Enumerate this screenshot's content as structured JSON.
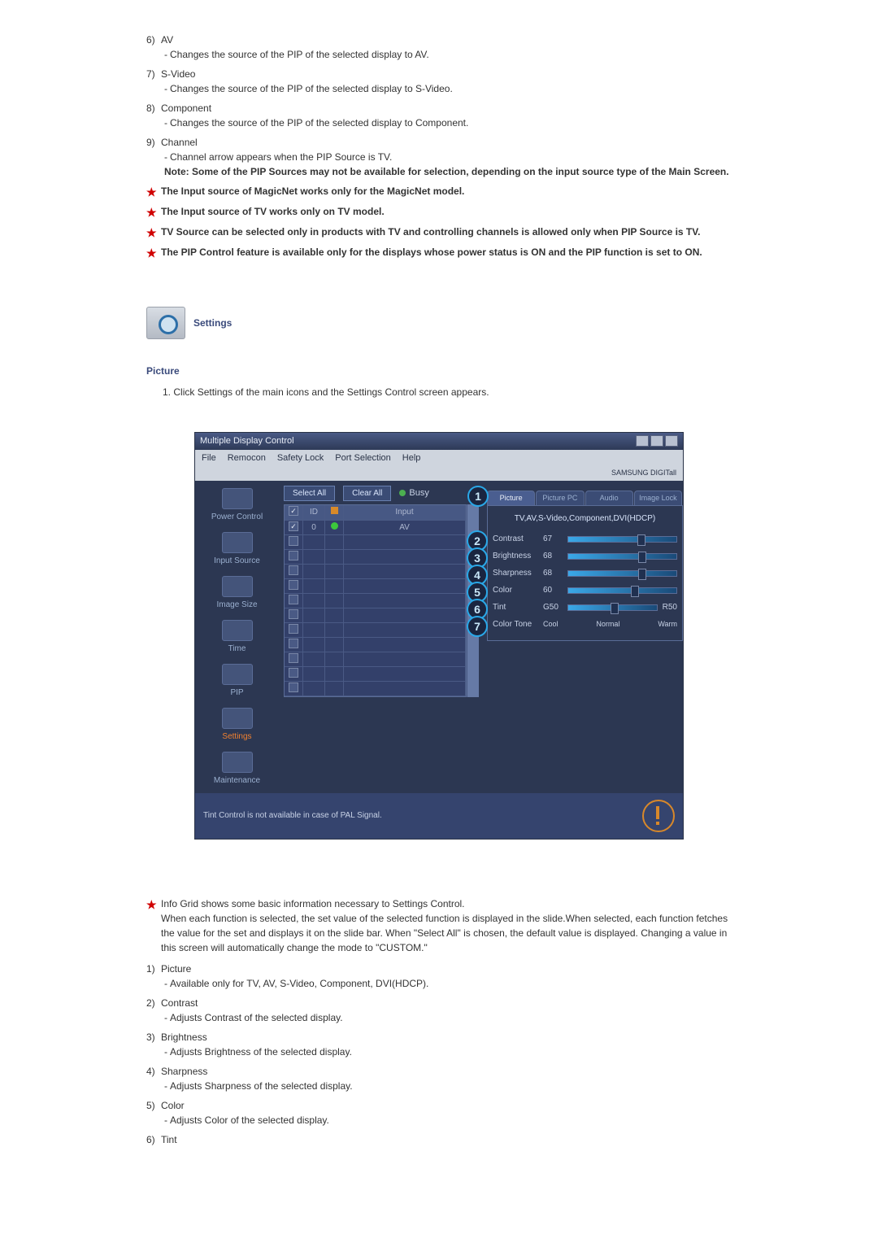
{
  "top_items": [
    {
      "num": "6)",
      "label": "AV",
      "desc": "Changes the source of the PIP of the selected display to AV."
    },
    {
      "num": "7)",
      "label": "S-Video",
      "desc": "Changes the source of the PIP of the selected display to S-Video."
    },
    {
      "num": "8)",
      "label": "Component",
      "desc": "Changes the source of the PIP of the selected display to Component."
    },
    {
      "num": "9)",
      "label": "Channel",
      "desc": "Channel arrow appears when the PIP Source is TV."
    }
  ],
  "channel_note": "Note: Some of the PIP Sources may not be available for selection, depending on the input source type of the Main Screen.",
  "stars_top": [
    "The Input source of MagicNet works only for the MagicNet model.",
    "The Input source of TV works only on TV model.",
    "TV Source can be selected only in products with TV and controlling channels is allowed only when PIP Source is TV.",
    "The PIP Control feature is available only for the displays whose power status is ON and the PIP function is set to ON."
  ],
  "settings_label": "Settings",
  "picture_label": "Picture",
  "picture_instr": "Click Settings of the main icons and the Settings Control screen appears.",
  "picture_instr_num": "1.",
  "shot": {
    "title": "Multiple Display Control",
    "brand": "SAMSUNG DIGITall",
    "menu": [
      "File",
      "Remocon",
      "Safety Lock",
      "Port Selection",
      "Help"
    ],
    "side": [
      "Power Control",
      "Input Source",
      "Image Size",
      "Time",
      "PIP",
      "Settings",
      "Maintenance"
    ],
    "select_all": "Select All",
    "clear_all": "Clear All",
    "busy": "Busy",
    "grid_head": [
      "",
      "ID",
      "",
      "Input"
    ],
    "grid_row": [
      "0",
      "AV"
    ],
    "tabs": [
      "Picture",
      "Picture PC",
      "Audio",
      "Image Lock"
    ],
    "panel_hint": "TV,AV,S-Video,Component,DVI(HDCP)",
    "controls": [
      {
        "n": "2",
        "label": "Contrast",
        "val": "67",
        "pos": "64%"
      },
      {
        "n": "3",
        "label": "Brightness",
        "val": "68",
        "pos": "65%"
      },
      {
        "n": "4",
        "label": "Sharpness",
        "val": "68",
        "pos": "65%"
      },
      {
        "n": "5",
        "label": "Color",
        "val": "60",
        "pos": "58%"
      },
      {
        "n": "6",
        "label": "Tint",
        "val": "G50",
        "pos": "48%",
        "right": "R50"
      },
      {
        "n": "7",
        "label": "Color Tone",
        "opts": [
          "Cool",
          "Normal",
          "Warm"
        ]
      }
    ],
    "balloon1": "1",
    "bottom_note": "Tint Control is not available in case of PAL Signal."
  },
  "star_after": "Info Grid shows some basic information necessary to Settings Control.",
  "info_para": "When each function is selected, the set value of the selected function is displayed in the slide.When selected, each function fetches the value for the set and displays it on the slide bar. When \"Select All\" is chosen, the default value is displayed. Changing a value in this screen will automatically change the mode to \"CUSTOM.\"",
  "bottom_items": [
    {
      "num": "1)",
      "label": "Picture",
      "desc": "Available only for TV, AV, S-Video, Component, DVI(HDCP)."
    },
    {
      "num": "2)",
      "label": "Contrast",
      "desc": "Adjusts Contrast of the selected display."
    },
    {
      "num": "3)",
      "label": "Brightness",
      "desc": "Adjusts Brightness of the selected display."
    },
    {
      "num": "4)",
      "label": "Sharpness",
      "desc": "Adjusts Sharpness of the selected display."
    },
    {
      "num": "5)",
      "label": "Color",
      "desc": "Adjusts Color of the selected display."
    },
    {
      "num": "6)",
      "label": "Tint",
      "desc": ""
    }
  ]
}
